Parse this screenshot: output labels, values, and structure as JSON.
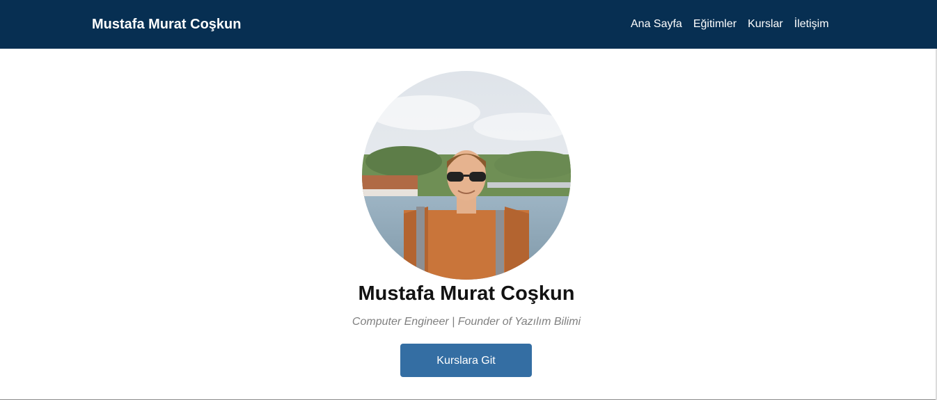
{
  "navbar": {
    "brand": "Mustafa Murat Coşkun",
    "background": "#072f52",
    "links": [
      {
        "label": "Ana Sayfa"
      },
      {
        "label": "Eğitimler"
      },
      {
        "label": "Kurslar"
      },
      {
        "label": "İletişim"
      }
    ]
  },
  "hero": {
    "name": "Mustafa Murat Coşkun",
    "subtitle": "Computer Engineer | Founder of Yazılım Bilimi",
    "button_label": "Kurslara Git",
    "button_color": "#346ea3"
  }
}
